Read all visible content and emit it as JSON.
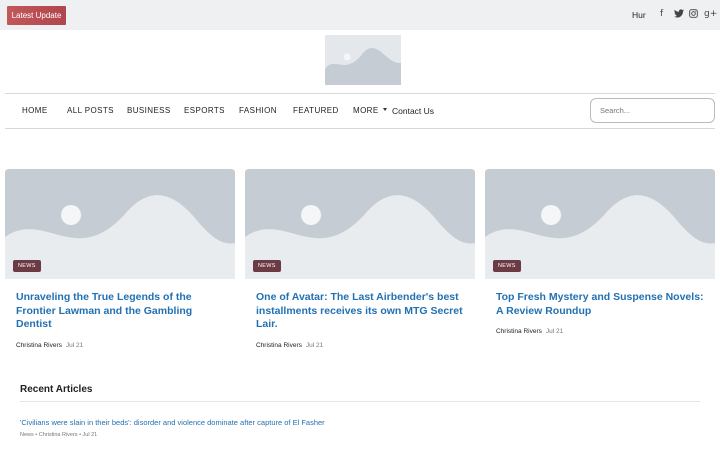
{
  "topbar": {
    "latest_label": "Latest Update",
    "ticker_text": "Hur",
    "social": [
      {
        "icon": "facebook-icon",
        "glyph": "f"
      },
      {
        "icon": "twitter-icon",
        "glyph": "🐦"
      },
      {
        "icon": "instagram-icon",
        "glyph": "◙"
      },
      {
        "icon": "google-plus-icon",
        "glyph": "g+"
      }
    ]
  },
  "nav": {
    "items": [
      "HOME",
      "ALL POSTS",
      "BUSINESS",
      "ESPORTS",
      "FASHION",
      "FEATURED",
      "MORE",
      "Contact Us"
    ],
    "search_placeholder": "Search..."
  },
  "cards": [
    {
      "badge": "NEWS",
      "title": "Unraveling the True Legends of the Frontier Lawman and the Gambling Dentist",
      "author": "Christina Rivers",
      "date": "Jul 21"
    },
    {
      "badge": "NEWS",
      "title": "One of Avatar: The Last Airbender's best installments receives its own MTG Secret Lair.",
      "author": "Christina Rivers",
      "date": "Jul 21"
    },
    {
      "badge": "NEWS",
      "title": "Top Fresh Mystery and Suspense Novels: A Review Roundup",
      "author": "Christina Rivers",
      "date": "Jul 21"
    }
  ],
  "recent": {
    "heading": "Recent Articles",
    "items": [
      {
        "title": "'Civilians were slain in their beds': disorder and violence dominate after capture of El Fasher",
        "meta": "News • Christina Rivers • Jul 21"
      }
    ]
  },
  "colors": {
    "accent_link": "#2271b3",
    "latest_button": "#c1585a",
    "badge": "#6b3a44",
    "placeholder_image": "#c5ccd3"
  }
}
